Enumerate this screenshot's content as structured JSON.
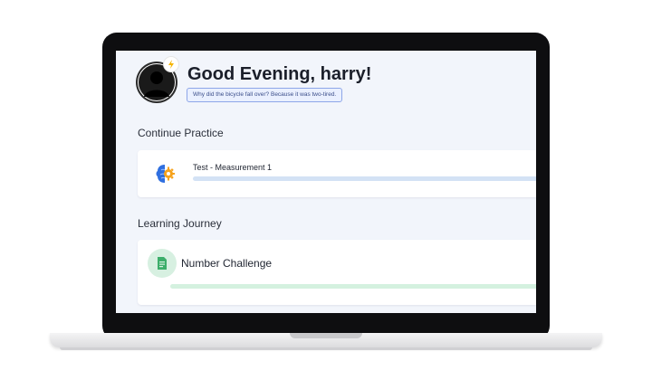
{
  "header": {
    "greeting": "Good Evening, harry!",
    "joke": "Why did the bicycle fall over? Because it was two-tired."
  },
  "continue_practice": {
    "title": "Continue Practice",
    "item": {
      "name": "Test - Measurement 1",
      "icon": "brain-gear-icon"
    }
  },
  "learning_journey": {
    "title": "Learning Journey",
    "item": {
      "name": "Number Challenge",
      "icon": "document-icon"
    }
  },
  "colors": {
    "screen_bg": "#f2f5fb",
    "practice_bar": "#d3e2f5",
    "challenge_bar": "#d4f1df",
    "challenge_icon_bg": "#d7f0e1",
    "joke_border": "#8ea6e8"
  }
}
